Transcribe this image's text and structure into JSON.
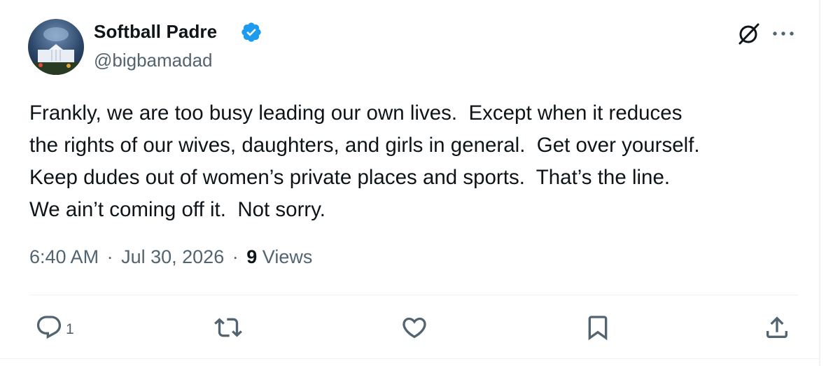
{
  "tweet": {
    "author": {
      "display_name": "Softball Padre",
      "handle": "@bigbamadad",
      "verified": true,
      "avatar": "avatar-white-house-night-icon"
    },
    "text": "Frankly, we are too busy leading our own lives.  Except when it reduces\nthe rights of our wives, daughters, and girls in general.  Get over yourself.\nKeep dudes out of women’s private places and sports.  That’s the line.\nWe ain’t coming off it.  Not sorry.",
    "time": "6:40 AM",
    "date": "Jul 30, 2026",
    "separator": "·",
    "views_count": "9",
    "views_label": "Views",
    "header_icons": [
      "grok-icon",
      "more-icon"
    ],
    "actions": {
      "reply_icon": "reply-icon",
      "reply_count": "1",
      "retweet_icon": "retweet-icon",
      "like_icon": "like-icon",
      "bookmark_icon": "bookmark-icon",
      "share_icon": "share-icon"
    }
  },
  "colors": {
    "text_primary": "#0f1419",
    "text_secondary": "#536471",
    "verified_blue": "#1d9bf0",
    "border": "#eff3f4",
    "background": "#ffffff"
  }
}
